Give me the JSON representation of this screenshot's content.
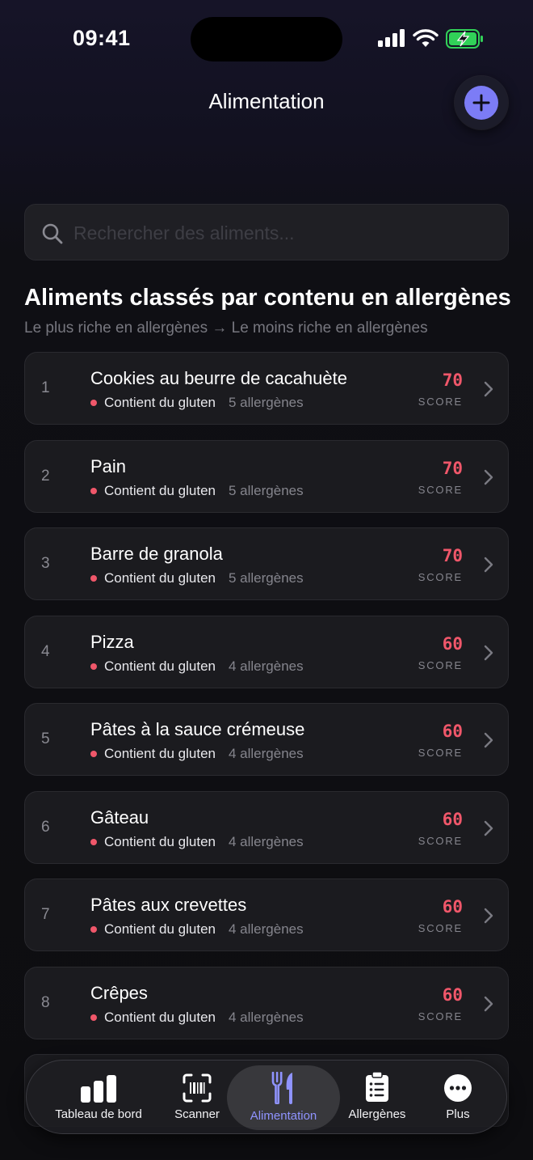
{
  "status_bar": {
    "time": "09:41"
  },
  "header": {
    "title": "Alimentation",
    "add_icon": "plus-icon"
  },
  "search": {
    "placeholder": "Rechercher des aliments..."
  },
  "section": {
    "title": "Aliments classés par contenu en allergènes",
    "subtitle": "Le plus riche en allergènes → Le moins riche en allergènes"
  },
  "score_label": "SCORE",
  "colors": {
    "accent": "#7c7cf6",
    "score": "#f0576a"
  },
  "foods": [
    {
      "rank": "1",
      "name": "Cookies au beurre de cacahuète",
      "tag": "Contient du gluten",
      "allergens": "5 allergènes",
      "score": "70"
    },
    {
      "rank": "2",
      "name": "Pain",
      "tag": "Contient du gluten",
      "allergens": "5 allergènes",
      "score": "70"
    },
    {
      "rank": "3",
      "name": "Barre de granola",
      "tag": "Contient du gluten",
      "allergens": "5 allergènes",
      "score": "70"
    },
    {
      "rank": "4",
      "name": "Pizza",
      "tag": "Contient du gluten",
      "allergens": "4 allergènes",
      "score": "60"
    },
    {
      "rank": "5",
      "name": "Pâtes à la sauce crémeuse",
      "tag": "Contient du gluten",
      "allergens": "4 allergènes",
      "score": "60"
    },
    {
      "rank": "6",
      "name": "Gâteau",
      "tag": "Contient du gluten",
      "allergens": "4 allergènes",
      "score": "60"
    },
    {
      "rank": "7",
      "name": "Pâtes aux crevettes",
      "tag": "Contient du gluten",
      "allergens": "4 allergènes",
      "score": "60"
    },
    {
      "rank": "8",
      "name": "Crêpes",
      "tag": "Contient du gluten",
      "allergens": "4 allergènes",
      "score": "60"
    }
  ],
  "tabbar": {
    "tabs": [
      {
        "label": "Tableau de bord",
        "icon": "bar-chart-icon"
      },
      {
        "label": "Scanner",
        "icon": "barcode-scan-icon"
      },
      {
        "label": "Alimentation",
        "icon": "fork-knife-icon",
        "active": true
      },
      {
        "label": "Allergènes",
        "icon": "clipboard-list-icon"
      },
      {
        "label": "Plus",
        "icon": "more-icon"
      }
    ]
  }
}
